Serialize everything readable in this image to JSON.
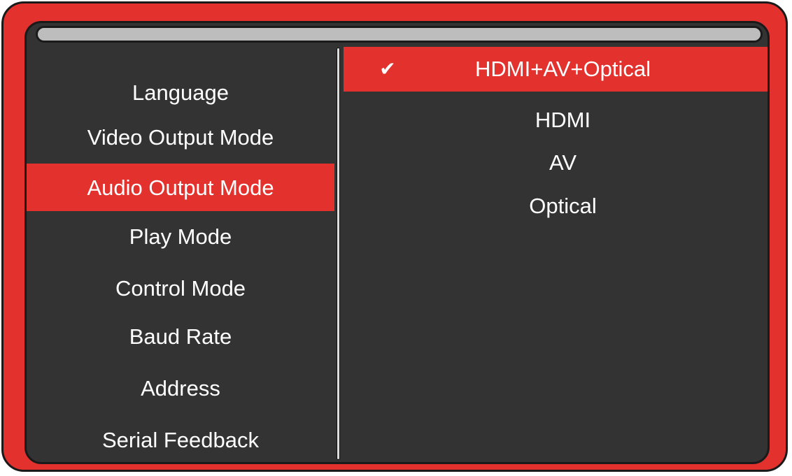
{
  "menu": {
    "items": [
      {
        "label": "Language"
      },
      {
        "label": "Video Output Mode"
      },
      {
        "label": "Audio Output Mode"
      },
      {
        "label": "Play Mode"
      },
      {
        "label": "Control Mode"
      },
      {
        "label": "Baud Rate"
      },
      {
        "label": "Address"
      },
      {
        "label": "Serial Feedback"
      }
    ],
    "selected": "Audio Output Mode"
  },
  "options": {
    "items": [
      {
        "label": "HDMI+AV+Optical"
      },
      {
        "label": "HDMI"
      },
      {
        "label": "AV"
      },
      {
        "label": "Optical"
      }
    ],
    "selected": "HDMI+AV+Optical",
    "check_glyph": "✔"
  },
  "colors": {
    "accent": "#e3312e",
    "screen_bg": "#333333",
    "text": "#ffffff",
    "titlebar": "#bdbdbd"
  },
  "icons": {
    "selected_option": "check-icon"
  }
}
